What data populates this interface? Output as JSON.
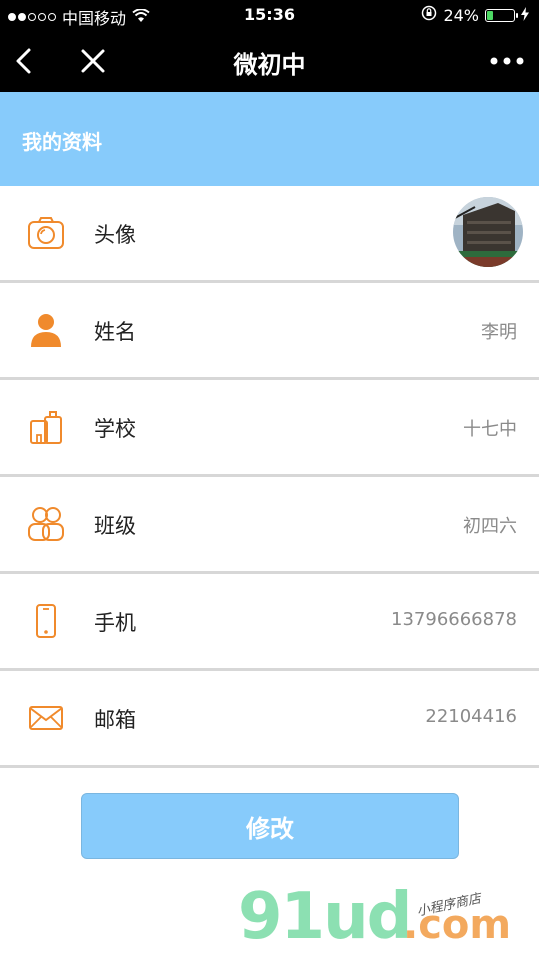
{
  "status_bar": {
    "carrier": "中国移动",
    "time": "15:36",
    "battery": "24%",
    "signal_bars_filled": 2,
    "signal_bars_total": 5
  },
  "nav": {
    "title": "微初中"
  },
  "section": {
    "title": "我的资料"
  },
  "rows": [
    {
      "label": "头像",
      "value": "",
      "icon": "camera-icon"
    },
    {
      "label": "姓名",
      "value": "李明",
      "icon": "user-icon"
    },
    {
      "label": "学校",
      "value": "十七中",
      "icon": "school-icon"
    },
    {
      "label": "班级",
      "value": "初四六",
      "icon": "group-icon"
    },
    {
      "label": "手机",
      "value": "13796666878",
      "icon": "phone-icon"
    },
    {
      "label": "邮箱",
      "value": "22104416",
      "icon": "mail-icon"
    }
  ],
  "button": {
    "label": "修改"
  },
  "watermark": {
    "logo": "91ud",
    "domain": ".com",
    "tagline": "小程序商店"
  },
  "colors": {
    "accent_blue": "#87cbfb",
    "icon_orange": "#f08a2c",
    "value_gray": "#8a8a8a"
  }
}
